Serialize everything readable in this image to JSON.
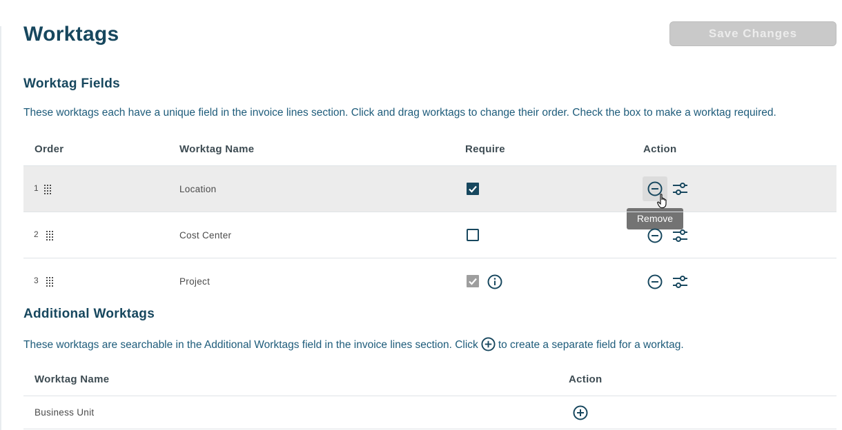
{
  "page": {
    "title": "Worktags",
    "save_label": "Save Changes"
  },
  "worktag_fields": {
    "title": "Worktag Fields",
    "description": "These worktags each have a unique field in the invoice lines section. Click and drag worktags to change their order. Check the box to make a worktag required.",
    "columns": {
      "order": "Order",
      "name": "Worktag Name",
      "require": "Require",
      "action": "Action"
    },
    "rows": [
      {
        "order": "1",
        "name": "Location",
        "required": true,
        "locked": false
      },
      {
        "order": "2",
        "name": "Cost Center",
        "required": false,
        "locked": false
      },
      {
        "order": "3",
        "name": "Project",
        "required": true,
        "locked": true
      }
    ],
    "tooltip": "Remove"
  },
  "additional": {
    "title": "Additional Worktags",
    "description_before": "These worktags are searchable in the Additional Worktags field in the invoice lines section. Click",
    "description_after": "to create a separate field for a worktag.",
    "columns": {
      "name": "Worktag Name",
      "action": "Action"
    },
    "rows": [
      {
        "name": "Business Unit"
      }
    ]
  },
  "colors": {
    "primary": "#17475e",
    "checkbox_checked": "#17475e",
    "checkbox_disabled": "#9e9e9e",
    "save_disabled": "#c9c9c9",
    "tooltip_bg": "#737373"
  }
}
